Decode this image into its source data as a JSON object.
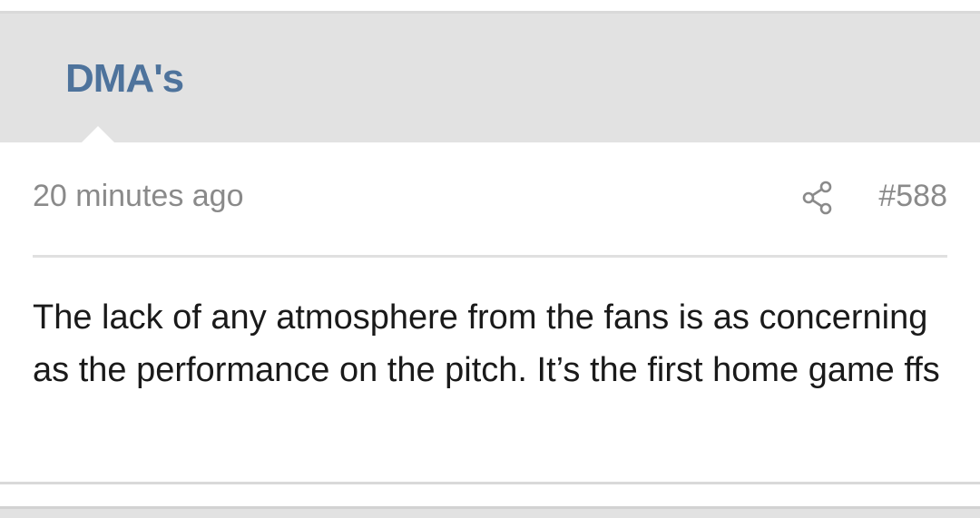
{
  "post": {
    "author": "DMA's",
    "timestamp": "20 minutes ago",
    "post_number": "#588",
    "message": "The lack of any atmosphere from the fans is as concerning as the performance on the pitch. It’s the first home game ffs",
    "share_icon": "share-icon"
  },
  "colors": {
    "author": "#4e739c",
    "header_bg": "#e2e2e2",
    "meta_text": "#8a8a8a",
    "body_text": "#1a1a1a"
  }
}
